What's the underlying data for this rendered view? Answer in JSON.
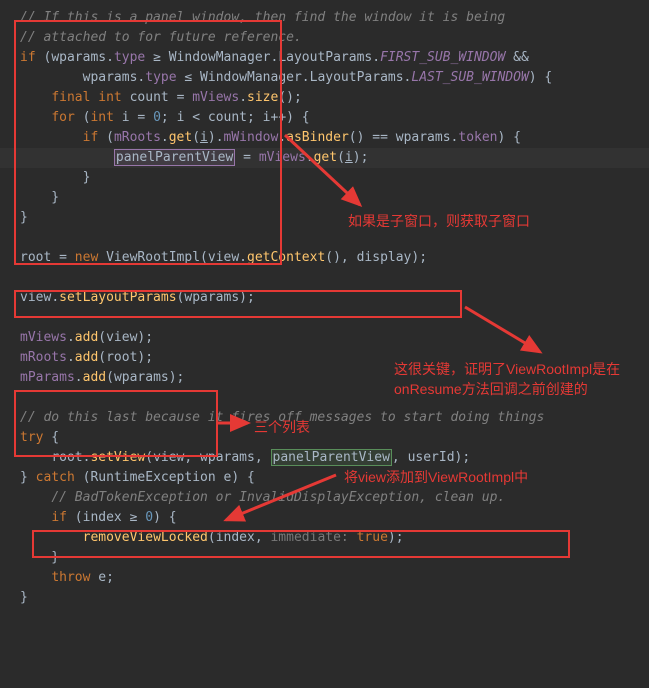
{
  "code": {
    "c1": "// If this is a panel window, then find the window it is being",
    "c2": "// attached to for future reference.",
    "if": "if",
    "wparams": "wparams",
    "type": "type",
    "ge": "≥",
    "wm": "WindowManager",
    "lp": "LayoutParams",
    "first_sub": "FIRST_SUB_WINDOW",
    "and": "&&",
    "le": "≤",
    "last_sub": "LAST_SUB_WINDOW",
    "final": "final",
    "int": "int",
    "count": "count",
    "eq": "=",
    "mViews": "mViews",
    "size": "size",
    "for": "for",
    "i": "i",
    "zero": "0",
    "lt": "<",
    "inc": "i++",
    "mRoots": "mRoots",
    "get": "get",
    "mWindow": "mWindow",
    "asBinder": "asBinder",
    "eqeq": "==",
    "token": "token",
    "panelParentView": "panelParentView",
    "root": "root",
    "new": "new",
    "ViewRootImpl": "ViewRootImpl",
    "view": "view",
    "getContext": "getContext",
    "display": "display",
    "setLayoutParams": "setLayoutParams",
    "add": "add",
    "mParams": "mParams",
    "c3": "// do this last because it fires off messages to start doing things",
    "try": "try",
    "setView": "setView",
    "userId": "userId",
    "catch": "catch",
    "RuntimeException": "RuntimeException",
    "e": "e",
    "c4": "// BadTokenException or InvalidDisplayException, clean up.",
    "index": "index",
    "removeViewLocked": "removeViewLocked",
    "immediate": "immediate:",
    "true": "true",
    "throw": "throw"
  },
  "annotations": {
    "a1": "如果是子窗口，则获取子窗口",
    "a2_l1": "这很关键，证明了ViewRootImpl是在",
    "a2_l2": "onResume方法回调之前创建的",
    "a3": "三个列表",
    "a4": "将view添加到ViewRootImpl中"
  },
  "colors": {
    "red": "#e53935",
    "bg": "#2b2b2b"
  }
}
